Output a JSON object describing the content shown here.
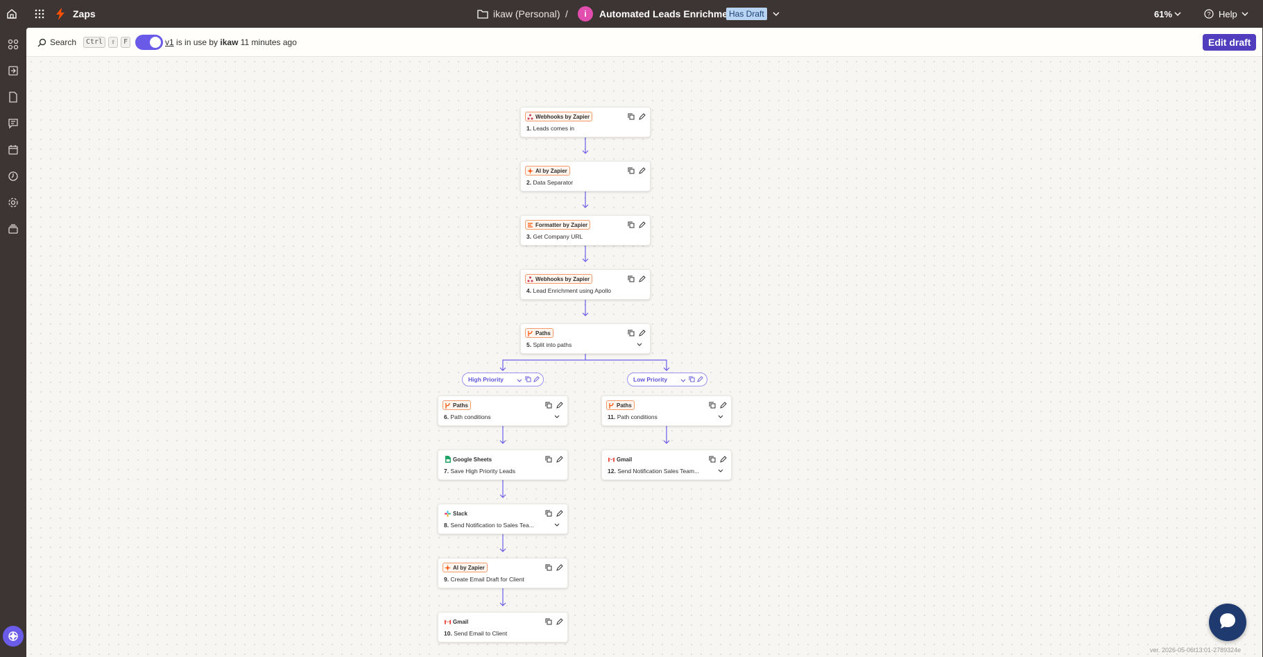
{
  "topbar": {
    "app_name": "Zaps",
    "folder": "ikaw (Personal)",
    "separator": "/",
    "zap_icon_letter": "i",
    "zap_title": "Automated Leads Enrichment",
    "draft_badge": "Has Draft",
    "zoom": "61%",
    "help": "Help"
  },
  "toolbar": {
    "search_label": "Search",
    "shortcut_ctrl": "Ctrl",
    "shortcut_shift": "⇧",
    "shortcut_f": "F",
    "version_link": "v1",
    "status_prefix": " is in use by ",
    "status_user": "ikaw",
    "status_time": " 11 minutes ago",
    "edit_draft": "Edit draft"
  },
  "steps": [
    {
      "app": "Webhooks by Zapier",
      "icon": "webhooks-icon",
      "num": "1.",
      "title": "Leads comes in"
    },
    {
      "app": "AI by Zapier",
      "icon": "ai-icon",
      "num": "2.",
      "title": "Data Separator"
    },
    {
      "app": "Formatter by Zapier",
      "icon": "formatter-icon",
      "num": "3.",
      "title": "Get Company URL"
    },
    {
      "app": "Webhooks by Zapier",
      "icon": "webhooks-icon",
      "num": "4.",
      "title": "Lead Enrichment using Apollo"
    },
    {
      "app": "Paths",
      "icon": "paths-icon",
      "num": "5.",
      "title": "Split into paths"
    },
    {
      "app": "Paths",
      "icon": "paths-icon",
      "num": "6.",
      "title": "Path conditions"
    },
    {
      "app": "Google Sheets",
      "icon": "google-sheets-icon",
      "num": "7.",
      "title": "Save High Priority Leads"
    },
    {
      "app": "Slack",
      "icon": "slack-icon",
      "num": "8.",
      "title": "Send Notification to Sales Tea..."
    },
    {
      "app": "AI by Zapier",
      "icon": "ai-icon",
      "num": "9.",
      "title": "Create Email Draft for Client"
    },
    {
      "app": "Gmail",
      "icon": "gmail-icon",
      "num": "10.",
      "title": "Send Email to Client"
    },
    {
      "app": "Paths",
      "icon": "paths-icon",
      "num": "11.",
      "title": "Path conditions"
    },
    {
      "app": "Gmail",
      "icon": "gmail-icon",
      "num": "12.",
      "title": "Send Notification Sales Team..."
    }
  ],
  "paths": {
    "left": "High Priority",
    "right": "Low Priority"
  },
  "footer": {
    "version": "ver. 2026-05-06t13:01-2789324e"
  },
  "colors": {
    "accent": "#503ebf",
    "toggle": "#695be8",
    "zapier_orange": "#ff4f00",
    "connector": "#6b5ce7",
    "badge_blue": "#b8d4f2"
  }
}
